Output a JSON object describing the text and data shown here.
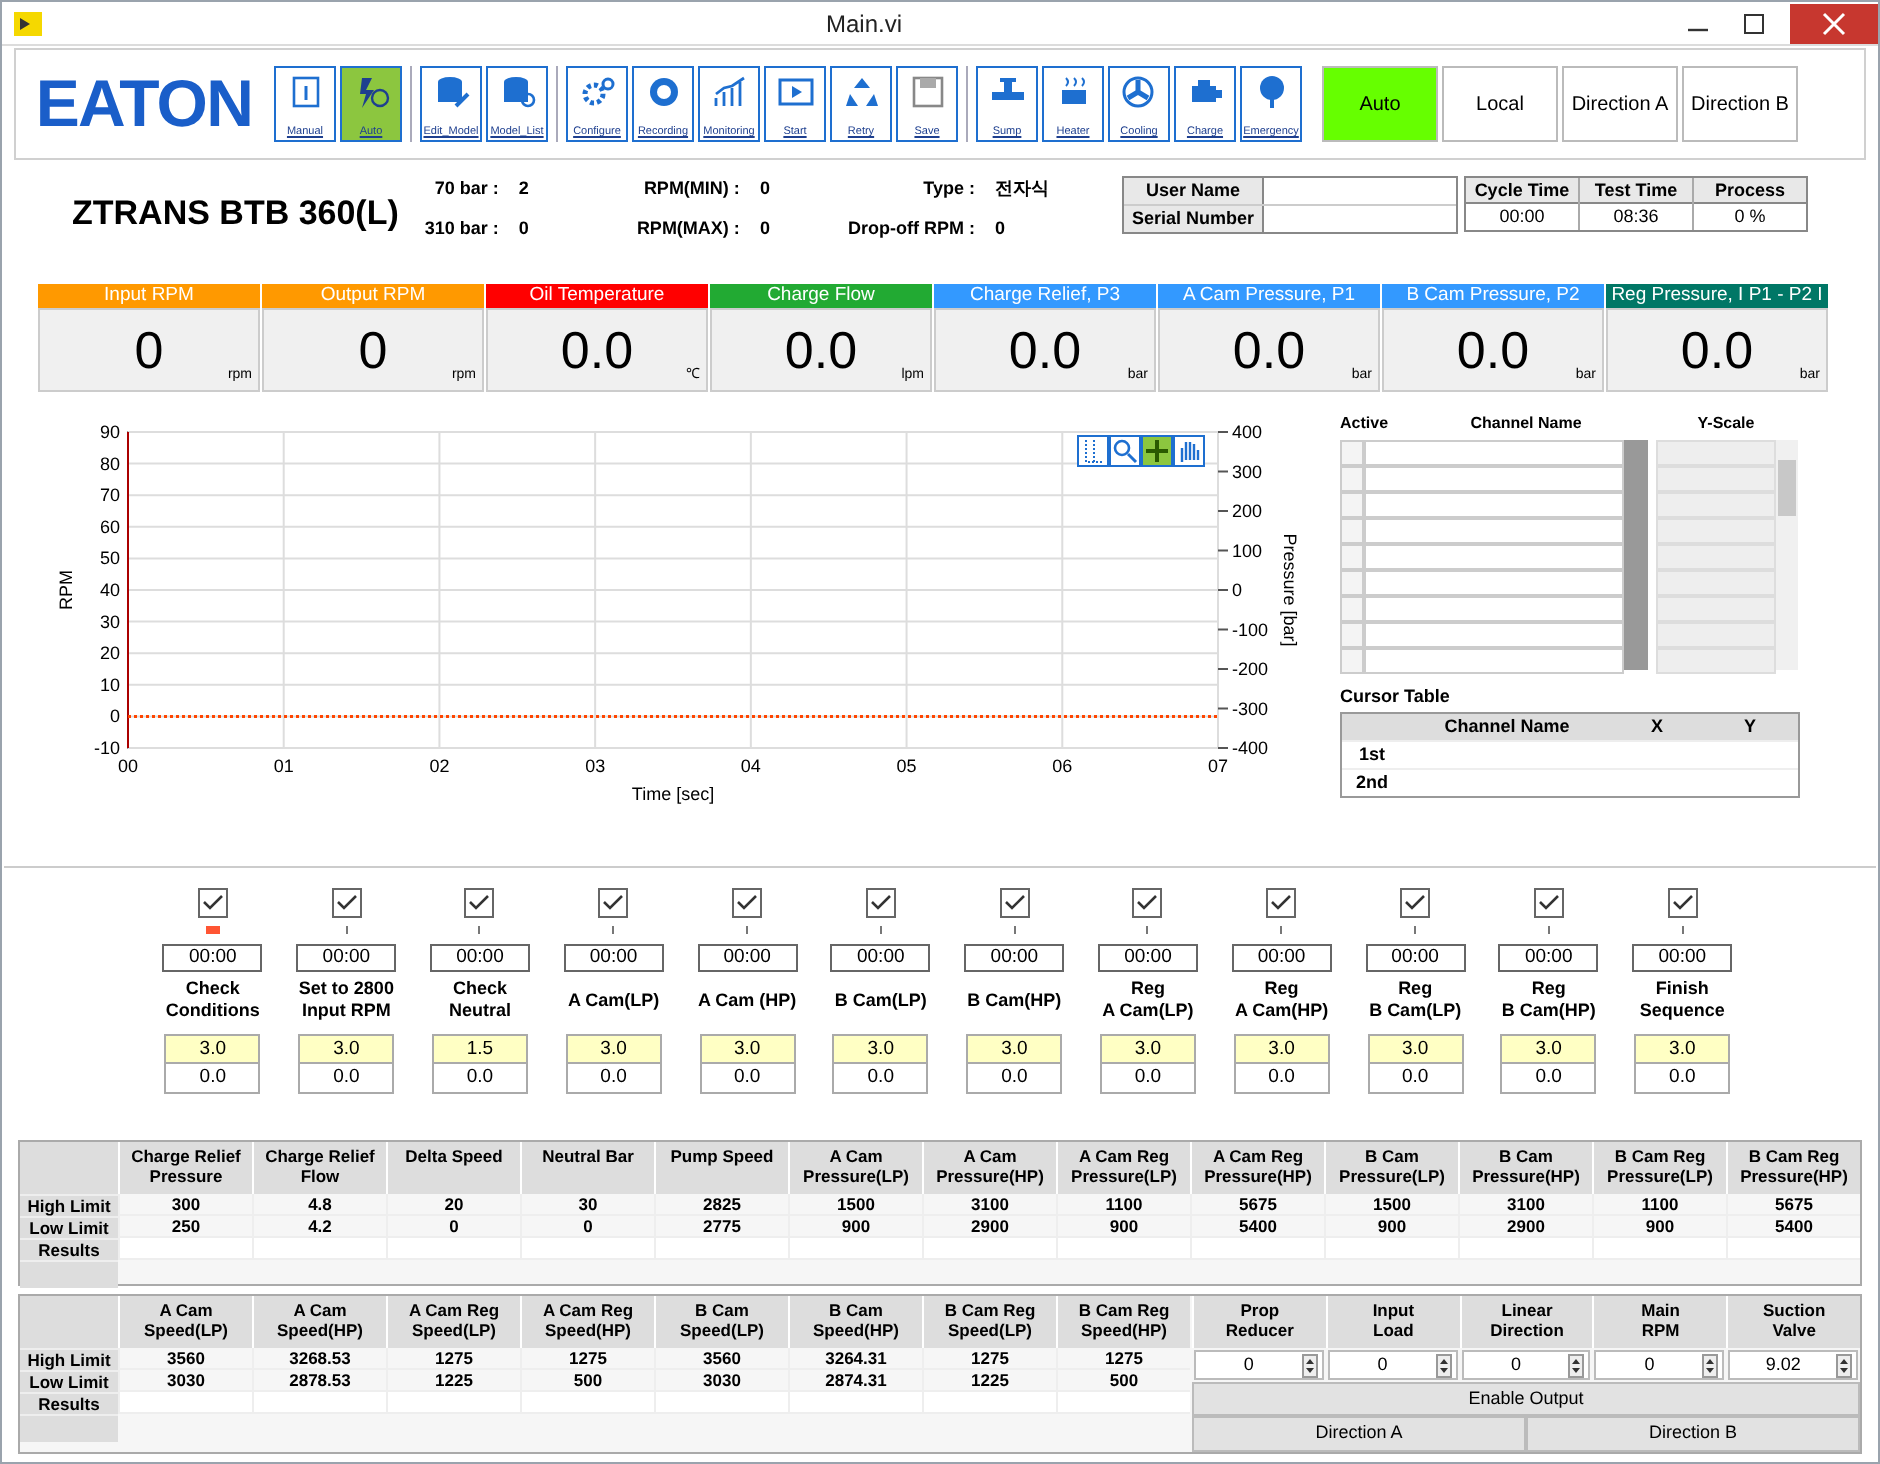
{
  "window": {
    "title": "Main.vi"
  },
  "logo": "EATON",
  "toolbar_groups": [
    [
      {
        "label": "Manual",
        "selected": false
      },
      {
        "label": "Auto",
        "selected": true
      }
    ],
    [
      {
        "label": "Edit_Model",
        "selected": false
      },
      {
        "label": "Model_List",
        "selected": false
      }
    ],
    [
      {
        "label": "Configure",
        "selected": false
      },
      {
        "label": "Recording",
        "selected": false
      },
      {
        "label": "Monitoring",
        "selected": false
      },
      {
        "label": "Start",
        "selected": false
      },
      {
        "label": "Retry",
        "selected": false
      },
      {
        "label": "Save",
        "selected": false
      }
    ],
    [
      {
        "label": "Sump",
        "selected": false
      },
      {
        "label": "Heater",
        "selected": false
      },
      {
        "label": "Cooling",
        "selected": false
      },
      {
        "label": "Charge",
        "selected": false
      },
      {
        "label": "Emergency",
        "selected": false
      }
    ]
  ],
  "mode_buttons": [
    {
      "label": "Auto",
      "selected": true
    },
    {
      "label": "Local",
      "selected": false
    },
    {
      "label": "Direction A",
      "selected": false
    },
    {
      "label": "Direction B",
      "selected": false
    }
  ],
  "model": "ZTRANS BTB 360(L)",
  "params": [
    {
      "label": "70 bar :",
      "value": "2"
    },
    {
      "label": "RPM(MIN) :",
      "value": "0"
    },
    {
      "label": "Type :",
      "value": "전자식"
    },
    {
      "label": "310 bar :",
      "value": "0"
    },
    {
      "label": "RPM(MAX) :",
      "value": "0"
    },
    {
      "label": "Drop-off RPM :",
      "value": "0"
    }
  ],
  "info_labels": [
    "User Name",
    "Serial Number"
  ],
  "timers": [
    {
      "label": "Cycle Time",
      "value": "00:00"
    },
    {
      "label": "Test Time",
      "value": "08:36"
    },
    {
      "label": "Process",
      "value": "0 %"
    }
  ],
  "gauges": [
    {
      "label": "Input RPM",
      "color": "#ff9900",
      "value": "0",
      "unit": "rpm"
    },
    {
      "label": "Output RPM",
      "color": "#ff9900",
      "value": "0",
      "unit": "rpm"
    },
    {
      "label": "Oil Temperature",
      "color": "#ff0000",
      "value": "0.0",
      "unit": "℃"
    },
    {
      "label": "Charge Flow",
      "color": "#22aa33",
      "value": "0.0",
      "unit": "lpm"
    },
    {
      "label": "Charge Relief, P3",
      "color": "#3399ff",
      "value": "0.0",
      "unit": "bar"
    },
    {
      "label": "A Cam Pressure, P1",
      "color": "#3399ff",
      "value": "0.0",
      "unit": "bar"
    },
    {
      "label": "B Cam Pressure, P2",
      "color": "#3399ff",
      "value": "0.0",
      "unit": "bar"
    },
    {
      "label": "Reg Pressure,  I P1 - P2 I",
      "color": "#007766",
      "value": "0.0",
      "unit": "bar"
    }
  ],
  "chart": {
    "chart_data": {
      "type": "line",
      "xlabel": "Time [sec]",
      "ylabel": "RPM",
      "y2label": "Pressure [bar]",
      "categories": [
        "00",
        "01",
        "02",
        "03",
        "04",
        "05",
        "06",
        "07"
      ],
      "ylim": [
        -10,
        90
      ],
      "yticks": [
        -10,
        0,
        10,
        20,
        30,
        40,
        50,
        60,
        70,
        80,
        90
      ],
      "y2ticks": [
        -400,
        -300,
        -200,
        -100,
        0,
        100,
        200,
        300,
        400
      ],
      "y2lim": [
        -400,
        400
      ],
      "grid": true,
      "line_style": "dotted",
      "series": [
        {
          "color": "#ff4500",
          "values": [
            0,
            0,
            0,
            0,
            0,
            0,
            0,
            0
          ]
        }
      ]
    }
  },
  "channel_table": {
    "columns": [
      "Active",
      "Channel Name",
      "Y-Scale"
    ]
  },
  "cursor_table": {
    "title": "Cursor Table",
    "columns": [
      "Channel Name",
      "X",
      "Y"
    ],
    "rows": [
      "1st",
      "2nd"
    ]
  },
  "steps": [
    {
      "checked": true,
      "current": true,
      "time": "00:00",
      "label": "Check\nConditions",
      "target": "3.0",
      "actual": "0.0"
    },
    {
      "checked": true,
      "current": false,
      "time": "00:00",
      "label": "Set to 2800\nInput RPM",
      "target": "3.0",
      "actual": "0.0"
    },
    {
      "checked": true,
      "current": false,
      "time": "00:00",
      "label": "Check\nNeutral",
      "target": "1.5",
      "actual": "0.0"
    },
    {
      "checked": true,
      "current": false,
      "time": "00:00",
      "label": "A Cam(LP)",
      "target": "3.0",
      "actual": "0.0"
    },
    {
      "checked": true,
      "current": false,
      "time": "00:00",
      "label": "A Cam (HP)",
      "target": "3.0",
      "actual": "0.0"
    },
    {
      "checked": true,
      "current": false,
      "time": "00:00",
      "label": "B Cam(LP)",
      "target": "3.0",
      "actual": "0.0"
    },
    {
      "checked": true,
      "current": false,
      "time": "00:00",
      "label": "B Cam(HP)",
      "target": "3.0",
      "actual": "0.0"
    },
    {
      "checked": true,
      "current": false,
      "time": "00:00",
      "label": "Reg\nA Cam(LP)",
      "target": "3.0",
      "actual": "0.0"
    },
    {
      "checked": true,
      "current": false,
      "time": "00:00",
      "label": "Reg\nA Cam(HP)",
      "target": "3.0",
      "actual": "0.0"
    },
    {
      "checked": true,
      "current": false,
      "time": "00:00",
      "label": "Reg\nB Cam(LP)",
      "target": "3.0",
      "actual": "0.0"
    },
    {
      "checked": true,
      "current": false,
      "time": "00:00",
      "label": "Reg\nB Cam(HP)",
      "target": "3.0",
      "actual": "0.0"
    },
    {
      "checked": true,
      "current": false,
      "time": "00:00",
      "label": "Finish\nSequence",
      "target": "3.0",
      "actual": "0.0"
    }
  ],
  "limits_table_1": {
    "row_labels": [
      "High Limit",
      "Low Limit",
      "Results"
    ],
    "columns": [
      {
        "header": "Charge Relief\nPressure",
        "high": "300",
        "low": "250"
      },
      {
        "header": "Charge Relief\nFlow",
        "high": "4.8",
        "low": "4.2"
      },
      {
        "header": "Delta Speed",
        "high": "20",
        "low": "0"
      },
      {
        "header": "Neutral Bar",
        "high": "30",
        "low": "0"
      },
      {
        "header": "Pump Speed",
        "high": "2825",
        "low": "2775"
      },
      {
        "header": "A Cam\nPressure(LP)",
        "high": "1500",
        "low": "900"
      },
      {
        "header": "A Cam\nPressure(HP)",
        "high": "3100",
        "low": "2900"
      },
      {
        "header": "A Cam Reg\nPressure(LP)",
        "high": "1100",
        "low": "900"
      },
      {
        "header": "A Cam Reg\nPressure(HP)",
        "high": "5675",
        "low": "5400"
      },
      {
        "header": "B Cam\nPressure(LP)",
        "high": "1500",
        "low": "900"
      },
      {
        "header": "B Cam\nPressure(HP)",
        "high": "3100",
        "low": "2900"
      },
      {
        "header": "B Cam Reg\nPressure(LP)",
        "high": "1100",
        "low": "900"
      },
      {
        "header": "B Cam Reg\nPressure(HP)",
        "high": "5675",
        "low": "5400"
      }
    ]
  },
  "limits_table_2": {
    "row_labels": [
      "High Limit",
      "Low Limit",
      "Results"
    ],
    "columns": [
      {
        "header": "A Cam\nSpeed(LP)",
        "high": "3560",
        "low": "3030"
      },
      {
        "header": "A Cam\nSpeed(HP)",
        "high": "3268.53",
        "low": "2878.53"
      },
      {
        "header": "A Cam Reg\nSpeed(LP)",
        "high": "1275",
        "low": "1225"
      },
      {
        "header": "A Cam Reg\nSpeed(HP)",
        "high": "1275",
        "low": "500"
      },
      {
        "header": "B Cam\nSpeed(LP)",
        "high": "3560",
        "low": "3030"
      },
      {
        "header": "B Cam\nSpeed(HP)",
        "high": "3264.31",
        "low": "2874.31"
      },
      {
        "header": "B Cam Reg\nSpeed(LP)",
        "high": "1275",
        "low": "1225"
      },
      {
        "header": "B Cam Reg\nSpeed(HP)",
        "high": "1275",
        "low": "500"
      }
    ]
  },
  "outputs": [
    {
      "label": "Prop\nReducer",
      "value": "0"
    },
    {
      "label": "Input\nLoad",
      "value": "0"
    },
    {
      "label": "Linear\nDirection",
      "value": "0"
    },
    {
      "label": "Main\nRPM",
      "value": "0"
    },
    {
      "label": "Suction\nValve",
      "value": "9.02"
    }
  ],
  "output_buttons": [
    "Enable Output"
  ],
  "direction_buttons": [
    "Direction A",
    "Direction B"
  ]
}
